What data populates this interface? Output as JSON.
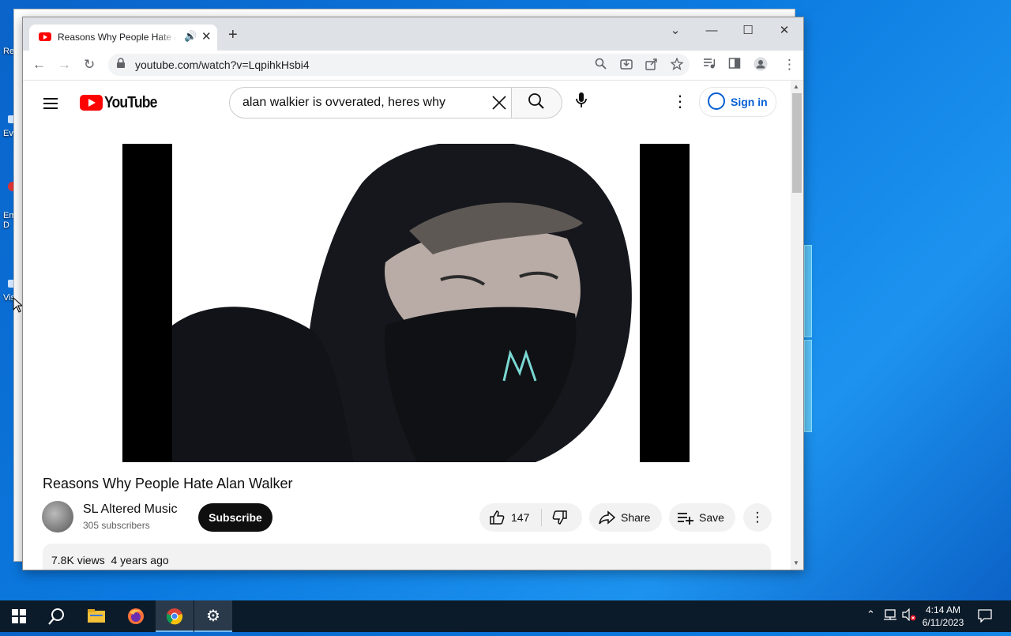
{
  "desktop": {
    "icon_labels": [
      "Re",
      "Ev",
      "Em\nD",
      "Vis"
    ]
  },
  "browser": {
    "tab": {
      "title": "Reasons Why People Hate Alan Walker - YouTube",
      "audio_icon": "speaker-icon",
      "close_icon": "close-icon"
    },
    "new_tab_icon": "plus-icon",
    "window_controls": {
      "tab_search": "⌄",
      "minimize": "—",
      "maximize": "☐",
      "close": "✕"
    },
    "toolbar": {
      "back_icon": "←",
      "forward_icon": "→",
      "reload_icon": "↻",
      "url": "youtube.com/watch?v=LqpihkHsbi4",
      "lock_icon": "🔒",
      "omnibox_icons": [
        "search-icon",
        "install-icon",
        "share-icon",
        "star-icon"
      ],
      "extra_icons": [
        "media-icon",
        "sidepanel-icon",
        "profile-icon",
        "menu-icon"
      ]
    }
  },
  "youtube": {
    "logo_text": "YouTube",
    "search": {
      "value": "alan walkier is ovverated, heres why",
      "clear_icon": "✕",
      "search_icon": "🔍"
    },
    "mic_icon": "🎤",
    "more_icon": "⋮",
    "sign_in_label": "Sign in",
    "video": {
      "title": "Reasons Why People Hate Alan Walker",
      "channel_name": "SL Altered Music",
      "subscribers": "305 subscribers",
      "subscribe_label": "Subscribe",
      "like_count": "147",
      "share_label": "Share",
      "save_label": "Save",
      "views": "7.8K views",
      "age": "4 years ago"
    }
  },
  "taskbar": {
    "clock_time": "4:14 AM",
    "clock_date": "6/11/2023",
    "items": [
      "start-icon",
      "search-icon",
      "file-explorer-icon",
      "firefox-icon",
      "chrome-icon",
      "settings-icon"
    ]
  },
  "colors": {
    "youtube_red": "#ff0000",
    "signin_blue": "#065fd4",
    "taskbar": "#0c1b2a",
    "desktop_blue": "#0b7ae0"
  }
}
